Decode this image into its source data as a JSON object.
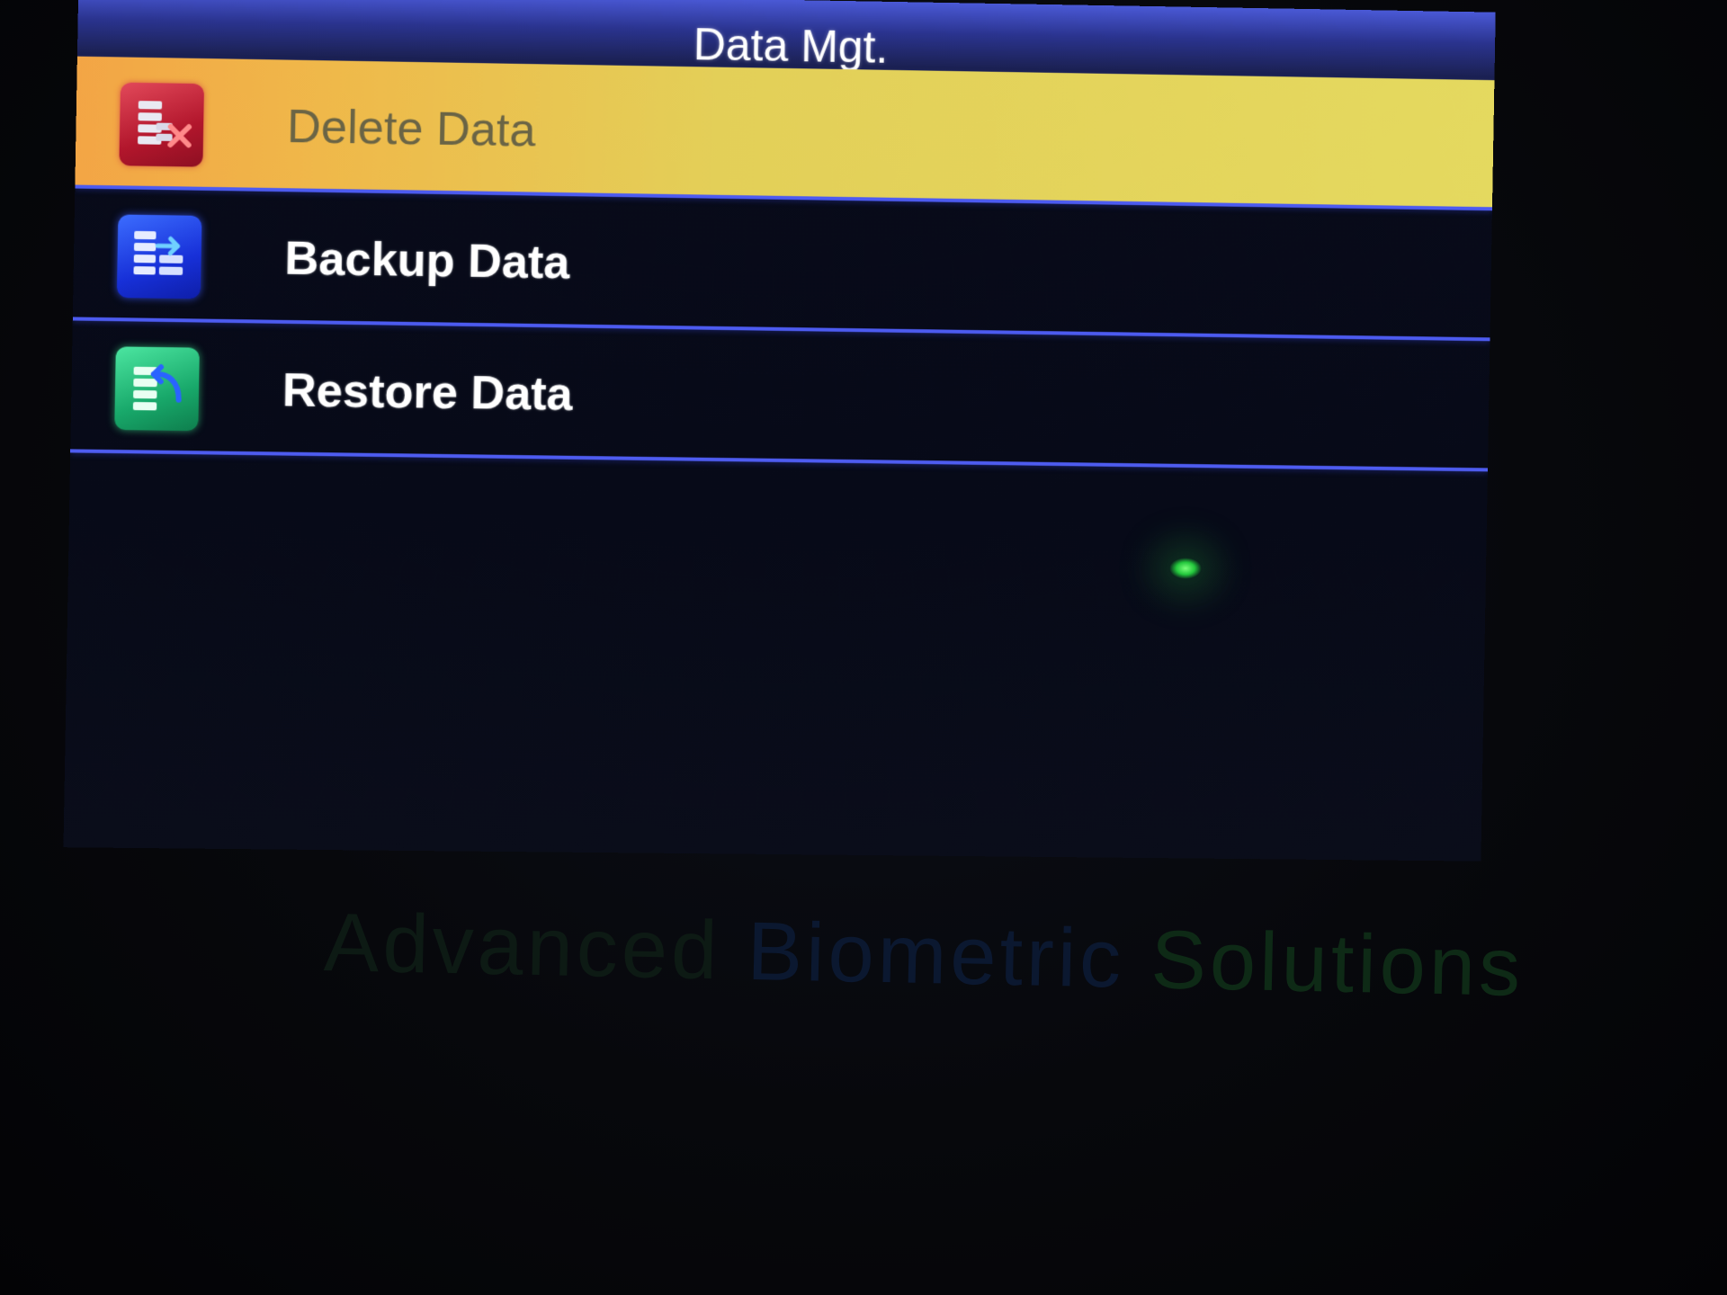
{
  "header": {
    "title": "Data Mgt."
  },
  "menu": {
    "items": [
      {
        "label": "Delete Data",
        "icon": "database-delete-icon",
        "selected": true,
        "icon_color": "#c0192f"
      },
      {
        "label": "Backup Data",
        "icon": "database-backup-icon",
        "selected": false,
        "icon_color": "#1d35e0"
      },
      {
        "label": "Restore Data",
        "icon": "database-restore-icon",
        "selected": false,
        "icon_color": "#19a86a"
      }
    ]
  },
  "device": {
    "brand_words": [
      "Advanced",
      "Biometric",
      "Solutions"
    ],
    "status_led_color": "#2bd13f"
  },
  "colors": {
    "title_bar": "#2a338e",
    "selection_start": "#f3a545",
    "selection_end": "#e4d95f",
    "separator": "#4e5cf0"
  }
}
